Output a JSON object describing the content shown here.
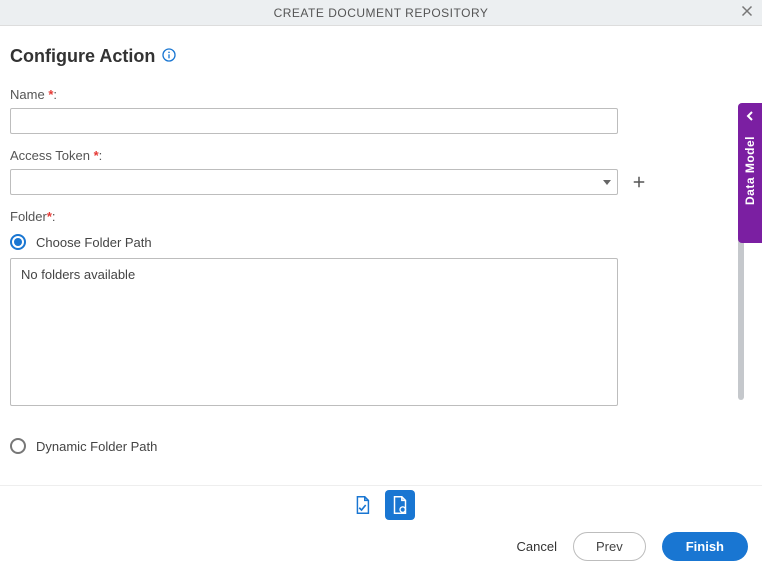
{
  "window": {
    "title": "CREATE DOCUMENT REPOSITORY"
  },
  "heading": "Configure Action",
  "fields": {
    "name_label": "Name",
    "name_value": "",
    "access_token_label": "Access Token",
    "access_token_value": "",
    "folder_label": "Folder"
  },
  "radios": {
    "choose_folder_path": "Choose Folder Path",
    "dynamic_folder_path": "Dynamic Folder Path"
  },
  "folder_box_text": "No folders available",
  "side_tab": {
    "label": "Data Model"
  },
  "buttons": {
    "cancel": "Cancel",
    "prev": "Prev",
    "finish": "Finish"
  },
  "punctuation": {
    "colon": ":",
    "asterisk": "*"
  }
}
